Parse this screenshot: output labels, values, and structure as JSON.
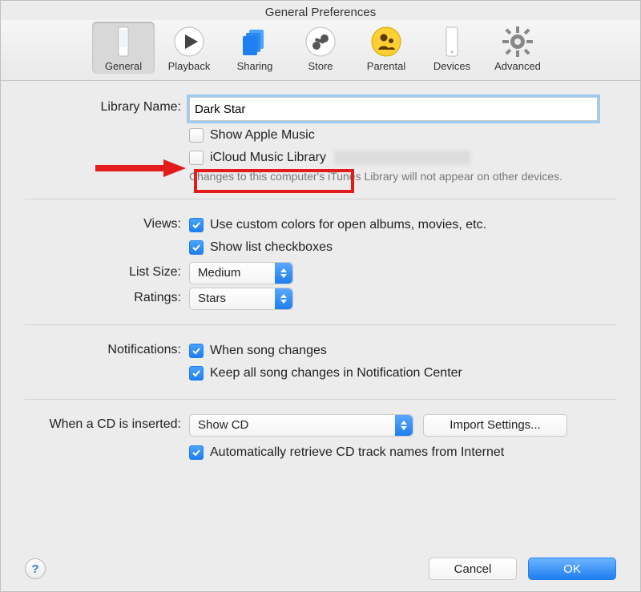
{
  "window": {
    "title": "General Preferences"
  },
  "toolbar": {
    "tabs": [
      {
        "label": "General",
        "selected": true
      },
      {
        "label": "Playback",
        "selected": false
      },
      {
        "label": "Sharing",
        "selected": false
      },
      {
        "label": "Store",
        "selected": false
      },
      {
        "label": "Parental",
        "selected": false
      },
      {
        "label": "Devices",
        "selected": false
      },
      {
        "label": "Advanced",
        "selected": false
      }
    ]
  },
  "library": {
    "label": "Library Name:",
    "value": "Dark Star",
    "show_apple_music": {
      "label": "Show Apple Music",
      "checked": false
    },
    "icloud_music_library": {
      "label": "iCloud Music Library",
      "checked": false
    },
    "note": "Changes to this computer's iTunes Library will not appear on other devices."
  },
  "views": {
    "label": "Views:",
    "custom_colors": {
      "label": "Use custom colors for open albums, movies, etc.",
      "checked": true
    },
    "show_list_checkboxes": {
      "label": "Show list checkboxes",
      "checked": true
    },
    "list_size": {
      "label": "List Size:",
      "value": "Medium"
    },
    "ratings": {
      "label": "Ratings:",
      "value": "Stars"
    }
  },
  "notifications": {
    "label": "Notifications:",
    "when_song_changes": {
      "label": "When song changes",
      "checked": true
    },
    "keep_in_center": {
      "label": "Keep all song changes in Notification Center",
      "checked": true
    }
  },
  "cd": {
    "label": "When a CD is inserted:",
    "action": {
      "value": "Show CD"
    },
    "import_settings": {
      "label": "Import Settings..."
    },
    "auto_retrieve": {
      "label": "Automatically retrieve CD track names from Internet",
      "checked": true
    }
  },
  "footer": {
    "cancel": "Cancel",
    "ok": "OK"
  },
  "colors": {
    "accent": "#1f7ef0",
    "annotation": "#e21b1b"
  }
}
